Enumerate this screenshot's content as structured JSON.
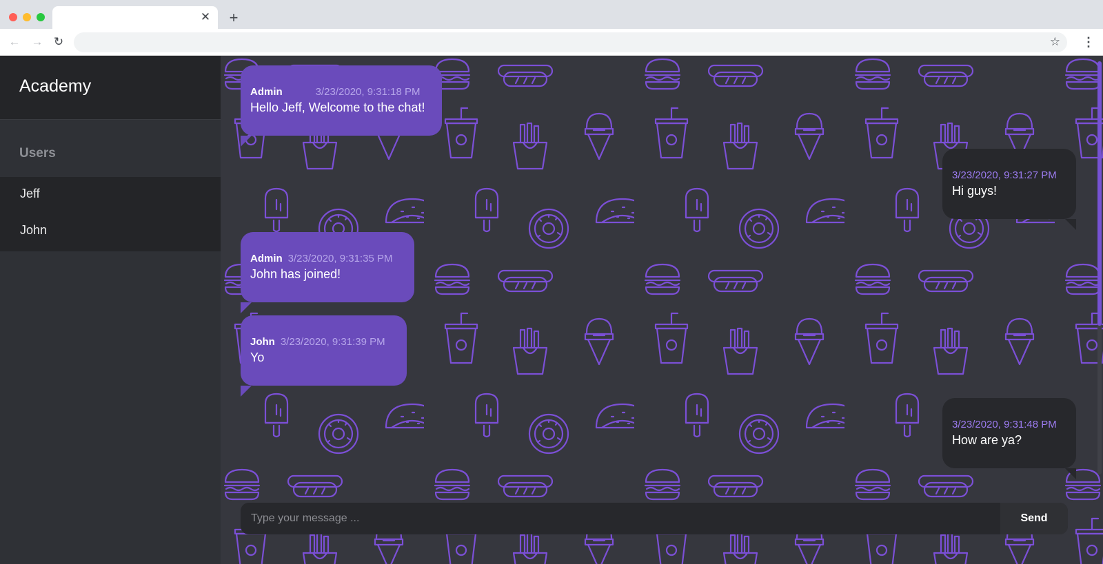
{
  "browser": {
    "tab_title": "",
    "tab_close": "✕",
    "new_tab": "+",
    "nav_back": "←",
    "nav_forward": "→",
    "nav_reload": "↻",
    "bookmark": "☆",
    "menu": "⋮",
    "url": ""
  },
  "sidebar": {
    "title": "Academy",
    "users_heading": "Users",
    "users": [
      "Jeff",
      "John"
    ]
  },
  "messages": [
    {
      "author": "Admin",
      "time": "3/23/2020, 9:31:18 PM",
      "text": "Hello Jeff, Welcome to the chat!"
    },
    {
      "author": "",
      "time": "3/23/2020, 9:31:27 PM",
      "text": "Hi guys!"
    },
    {
      "author": "Admin",
      "time": "3/23/2020, 9:31:35 PM",
      "text": "John has joined!"
    },
    {
      "author": "John",
      "time": "3/23/2020, 9:31:39 PM",
      "text": "Yo"
    },
    {
      "author": "",
      "time": "3/23/2020, 9:31:48 PM",
      "text": "How are ya?"
    }
  ],
  "composer": {
    "placeholder": "Type your message ...",
    "send_label": "Send"
  },
  "colors": {
    "accent": "#6a4bbb",
    "pattern": "#7b4fd6",
    "chat_background": "#36373e",
    "sidebar": "#2f3136",
    "own_bubble": "#27282c"
  }
}
